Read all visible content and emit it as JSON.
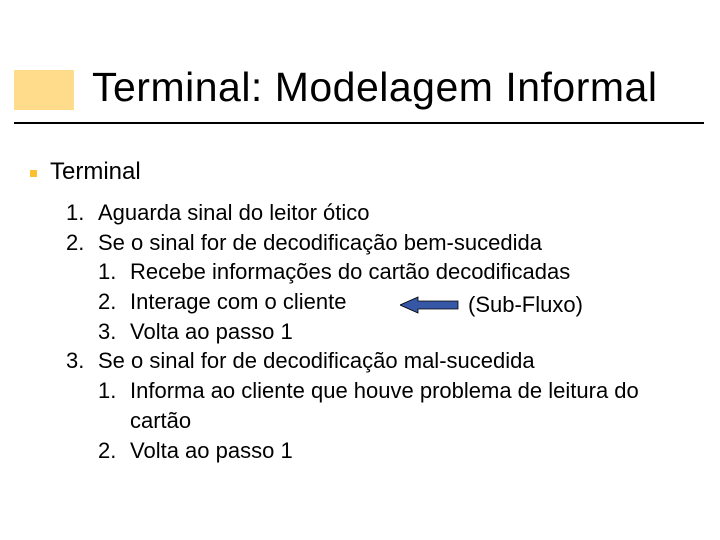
{
  "title": "Terminal: Modelagem Informal",
  "subheading": "Terminal",
  "annotation": "(Sub-Fluxo)",
  "list": {
    "items": [
      {
        "num": "1.",
        "text": "Aguarda sinal do leitor ótico"
      },
      {
        "num": "2.",
        "text": "Se o sinal for de decodificação bem-sucedida",
        "sub": [
          {
            "num": "1.",
            "text": "Recebe informações do cartão decodificadas"
          },
          {
            "num": "2.",
            "text": "Interage com o cliente"
          },
          {
            "num": "3.",
            "text": "Volta ao passo 1"
          }
        ]
      },
      {
        "num": "3.",
        "text": "Se o sinal for de decodificação mal-sucedida",
        "sub": [
          {
            "num": "1.",
            "text": "Informa ao cliente que houve problema de leitura do cartão"
          },
          {
            "num": "2.",
            "text": "Volta ao passo 1"
          }
        ]
      }
    ]
  }
}
